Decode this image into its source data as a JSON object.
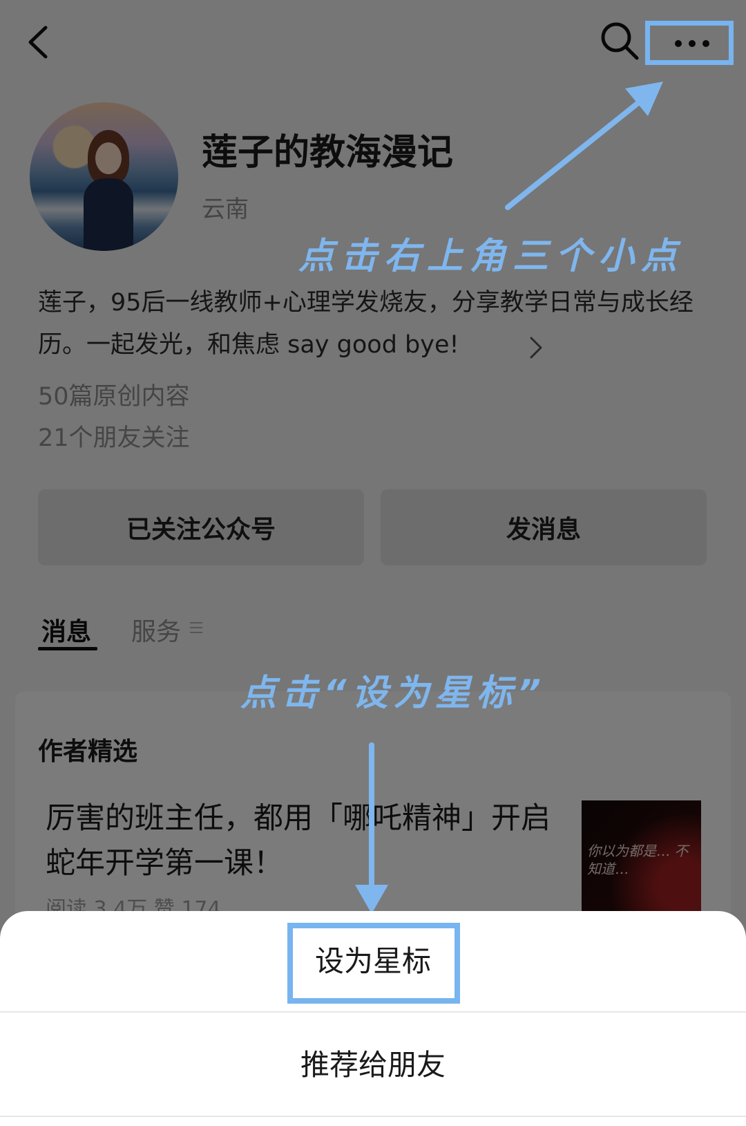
{
  "header": {
    "back_icon": "chevron-left-icon",
    "search_icon": "search-icon",
    "more_icon": "more-horizontal-icon"
  },
  "profile": {
    "name": "莲子的教海漫记",
    "location": "云南",
    "bio": "莲子，95后一线教师+心理学发烧友，分享教学日常与成长经历。一起发光，和焦虑 say good bye!",
    "original_count": "50篇原创内容",
    "friends_following": "21个朋友关注"
  },
  "actions": {
    "followed_label": "已关注公众号",
    "message_label": "发消息"
  },
  "tabs": [
    {
      "label": "消息",
      "active": true
    },
    {
      "label": "服务",
      "active": false
    }
  ],
  "featured": {
    "section_title": "作者精选",
    "article_title": "厉害的班主任，都用「哪吒精神」开启蛇年开学第一课！",
    "article_meta": "阅读 3.4万  赞 174",
    "thumb_text": "你以为都是…   不知道…"
  },
  "annotations": {
    "step1": "点击右上角三个小点",
    "step2": "点击“设为星标”",
    "highlight_color": "#78b4f0"
  },
  "sheet": {
    "options": [
      "设为星标",
      "推荐给朋友"
    ]
  }
}
